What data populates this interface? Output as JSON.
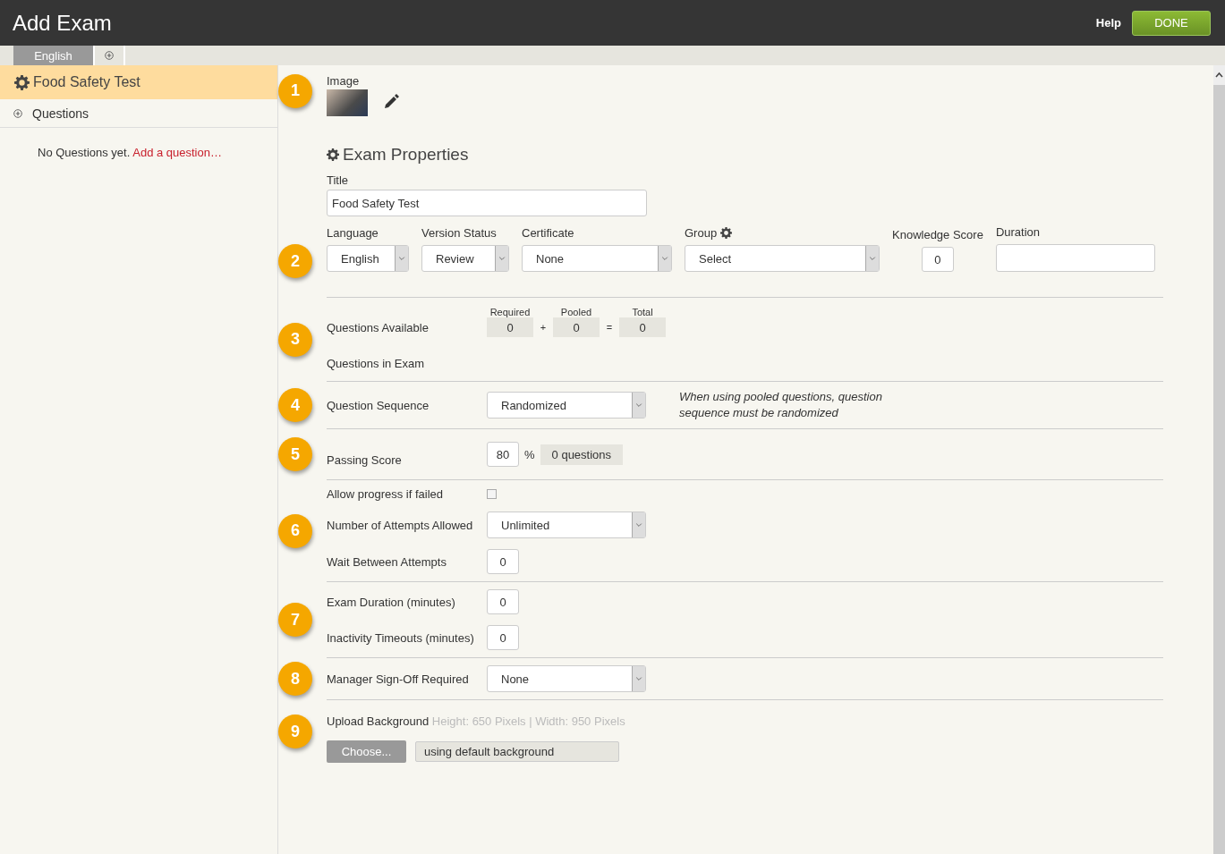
{
  "header": {
    "title": "Add Exam",
    "help": "Help",
    "done": "DONE"
  },
  "language_tabs": [
    {
      "label": "English",
      "selected": true
    }
  ],
  "sidebar": {
    "exam": "Food Safety Test",
    "selected": true,
    "questions": "Questions",
    "empty_text": "No Questions yet.",
    "add_link": "Add a question…"
  },
  "sections": [
    {
      "step": "1",
      "kind": "image",
      "label": "Image"
    },
    {
      "kind": "heading",
      "heading": "Exam Properties",
      "title_label": "Title",
      "title_value": "Food Safety Test"
    },
    {
      "step": "2",
      "kind": "fields",
      "fields": [
        {
          "kind": "select",
          "label": "Language",
          "value": "English"
        },
        {
          "kind": "select",
          "label": "Version Status",
          "value": "Review"
        },
        {
          "kind": "select",
          "label": "Certificate",
          "value": "None"
        },
        {
          "kind": "settings_select",
          "label": "Group",
          "value": "Select"
        },
        {
          "kind": "number",
          "label": "Knowledge Score",
          "value": "0"
        },
        {
          "kind": "text",
          "label": "Duration"
        }
      ]
    },
    {
      "step": "3",
      "kind": "counts",
      "labels": [
        "Questions Available",
        "Questions in Exam"
      ],
      "columns": [
        {
          "label": "Required",
          "value": "0"
        },
        {
          "label": "Pooled",
          "value": "0"
        },
        {
          "label": "Total",
          "value": "0"
        }
      ],
      "operators": [
        "+",
        "="
      ]
    },
    {
      "step": "4",
      "kind": "rows",
      "rows": [
        {
          "kind": "select",
          "label": "Question Sequence",
          "value": "Randomized",
          "note": "When using pooled questions, question sequence must be randomized"
        }
      ]
    },
    {
      "step": "5",
      "kind": "passing",
      "label": "Passing Score",
      "value": "80",
      "unit": "%",
      "summary": "0 questions"
    },
    {
      "step": "6",
      "kind": "rows",
      "rows": [
        {
          "kind": "checkbox",
          "label": "Allow progress if failed",
          "checked": false
        },
        {
          "kind": "select",
          "label": "Number of Attempts Allowed",
          "value": "Unlimited"
        },
        {
          "kind": "number",
          "label": "Wait Between Attempts",
          "value": "0"
        }
      ]
    },
    {
      "step": "7",
      "kind": "rows",
      "rows": [
        {
          "kind": "number",
          "label": "Exam Duration (minutes)",
          "value": "0"
        },
        {
          "kind": "number",
          "label": "Inactivity Timeouts (minutes)",
          "value": "0"
        }
      ]
    },
    {
      "step": "8",
      "kind": "rows",
      "rows": [
        {
          "kind": "select",
          "label": "Manager Sign-Off Required",
          "value": "None"
        }
      ]
    },
    {
      "step": "9",
      "kind": "upload",
      "label": "Upload Background",
      "hint": "Height: 650 Pixels | Width: 950 Pixels",
      "button": "Choose...",
      "file": "using default background"
    }
  ]
}
